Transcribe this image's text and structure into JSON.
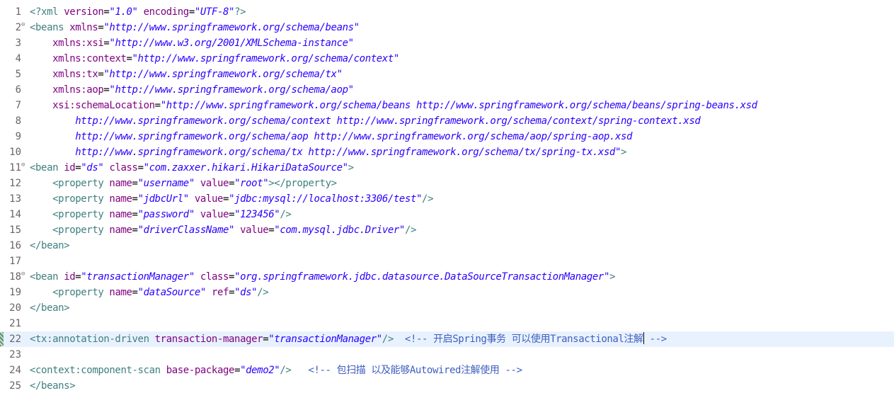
{
  "editor": {
    "current_line": 22,
    "lines": [
      {
        "n": "1",
        "fold": "",
        "tokens": [
          {
            "t": "tag",
            "s": "<?xml "
          },
          {
            "t": "attr",
            "s": "version"
          },
          {
            "t": "text",
            "s": "="
          },
          {
            "t": "val",
            "s": "\"1.0\""
          },
          {
            "t": "text",
            "s": " "
          },
          {
            "t": "attr",
            "s": "encoding"
          },
          {
            "t": "text",
            "s": "="
          },
          {
            "t": "val",
            "s": "\"UTF-8\""
          },
          {
            "t": "tag",
            "s": "?>"
          }
        ]
      },
      {
        "n": "2",
        "fold": "⊖",
        "tokens": [
          {
            "t": "tag",
            "s": "<beans "
          },
          {
            "t": "attr",
            "s": "xmlns"
          },
          {
            "t": "text",
            "s": "="
          },
          {
            "t": "val",
            "s": "\"http://www.springframework.org/schema/beans\""
          }
        ]
      },
      {
        "n": "3",
        "fold": "",
        "tokens": [
          {
            "t": "text",
            "s": "    "
          },
          {
            "t": "attr",
            "s": "xmlns:xsi"
          },
          {
            "t": "text",
            "s": "="
          },
          {
            "t": "val",
            "s": "\"http://www.w3.org/2001/XMLSchema-instance\""
          }
        ]
      },
      {
        "n": "4",
        "fold": "",
        "tokens": [
          {
            "t": "text",
            "s": "    "
          },
          {
            "t": "attr",
            "s": "xmlns:context"
          },
          {
            "t": "text",
            "s": "="
          },
          {
            "t": "val",
            "s": "\"http://www.springframework.org/schema/context\""
          }
        ]
      },
      {
        "n": "5",
        "fold": "",
        "tokens": [
          {
            "t": "text",
            "s": "    "
          },
          {
            "t": "attr",
            "s": "xmlns:tx"
          },
          {
            "t": "text",
            "s": "="
          },
          {
            "t": "val",
            "s": "\"http://www.springframework.org/schema/tx\""
          }
        ]
      },
      {
        "n": "6",
        "fold": "",
        "tokens": [
          {
            "t": "text",
            "s": "    "
          },
          {
            "t": "attr",
            "s": "xmlns:aop"
          },
          {
            "t": "text",
            "s": "="
          },
          {
            "t": "val",
            "s": "\"http://www.springframework.org/schema/aop\""
          }
        ]
      },
      {
        "n": "7",
        "fold": "",
        "tokens": [
          {
            "t": "text",
            "s": "    "
          },
          {
            "t": "attr",
            "s": "xsi:schemaLocation"
          },
          {
            "t": "text",
            "s": "="
          },
          {
            "t": "val",
            "s": "\"http://www.springframework.org/schema/beans http://www.springframework.org/schema/beans/spring-beans.xsd"
          }
        ]
      },
      {
        "n": "8",
        "fold": "",
        "tokens": [
          {
            "t": "text",
            "s": "        "
          },
          {
            "t": "val",
            "s": "http://www.springframework.org/schema/context http://www.springframework.org/schema/context/spring-context.xsd"
          }
        ]
      },
      {
        "n": "9",
        "fold": "",
        "tokens": [
          {
            "t": "text",
            "s": "        "
          },
          {
            "t": "val",
            "s": "http://www.springframework.org/schema/aop http://www.springframework.org/schema/aop/spring-aop.xsd"
          }
        ]
      },
      {
        "n": "10",
        "fold": "",
        "tokens": [
          {
            "t": "text",
            "s": "        "
          },
          {
            "t": "val",
            "s": "http://www.springframework.org/schema/tx http://www.springframework.org/schema/tx/spring-tx.xsd\""
          },
          {
            "t": "tag",
            "s": ">"
          }
        ]
      },
      {
        "n": "11",
        "fold": "⊖",
        "tokens": [
          {
            "t": "tag",
            "s": "<bean "
          },
          {
            "t": "attr",
            "s": "id"
          },
          {
            "t": "text",
            "s": "="
          },
          {
            "t": "val",
            "s": "\"ds\""
          },
          {
            "t": "text",
            "s": " "
          },
          {
            "t": "attr",
            "s": "class"
          },
          {
            "t": "text",
            "s": "="
          },
          {
            "t": "val",
            "s": "\"com.zaxxer.hikari.HikariDataSource\""
          },
          {
            "t": "tag",
            "s": ">"
          }
        ]
      },
      {
        "n": "12",
        "fold": "",
        "tokens": [
          {
            "t": "text",
            "s": "    "
          },
          {
            "t": "tag",
            "s": "<property "
          },
          {
            "t": "attr",
            "s": "name"
          },
          {
            "t": "text",
            "s": "="
          },
          {
            "t": "val",
            "s": "\"username\""
          },
          {
            "t": "text",
            "s": " "
          },
          {
            "t": "attr",
            "s": "value"
          },
          {
            "t": "text",
            "s": "="
          },
          {
            "t": "val",
            "s": "\"root\""
          },
          {
            "t": "tag",
            "s": "></property>"
          }
        ]
      },
      {
        "n": "13",
        "fold": "",
        "tokens": [
          {
            "t": "text",
            "s": "    "
          },
          {
            "t": "tag",
            "s": "<property "
          },
          {
            "t": "attr",
            "s": "name"
          },
          {
            "t": "text",
            "s": "="
          },
          {
            "t": "val",
            "s": "\"jdbcUrl\""
          },
          {
            "t": "text",
            "s": " "
          },
          {
            "t": "attr",
            "s": "value"
          },
          {
            "t": "text",
            "s": "="
          },
          {
            "t": "val",
            "s": "\"jdbc:mysql://localhost:3306/test\""
          },
          {
            "t": "tag",
            "s": "/>"
          }
        ]
      },
      {
        "n": "14",
        "fold": "",
        "tokens": [
          {
            "t": "text",
            "s": "    "
          },
          {
            "t": "tag",
            "s": "<property "
          },
          {
            "t": "attr",
            "s": "name"
          },
          {
            "t": "text",
            "s": "="
          },
          {
            "t": "val",
            "s": "\"password\""
          },
          {
            "t": "text",
            "s": " "
          },
          {
            "t": "attr",
            "s": "value"
          },
          {
            "t": "text",
            "s": "="
          },
          {
            "t": "val",
            "s": "\"123456\""
          },
          {
            "t": "tag",
            "s": "/>"
          }
        ]
      },
      {
        "n": "15",
        "fold": "",
        "tokens": [
          {
            "t": "text",
            "s": "    "
          },
          {
            "t": "tag",
            "s": "<property "
          },
          {
            "t": "attr",
            "s": "name"
          },
          {
            "t": "text",
            "s": "="
          },
          {
            "t": "val",
            "s": "\"driverClassName\""
          },
          {
            "t": "text",
            "s": " "
          },
          {
            "t": "attr",
            "s": "value"
          },
          {
            "t": "text",
            "s": "="
          },
          {
            "t": "val",
            "s": "\"com.mysql.jdbc.Driver\""
          },
          {
            "t": "tag",
            "s": "/>"
          }
        ]
      },
      {
        "n": "16",
        "fold": "",
        "tokens": [
          {
            "t": "tag",
            "s": "</bean>"
          }
        ]
      },
      {
        "n": "17",
        "fold": "",
        "tokens": []
      },
      {
        "n": "18",
        "fold": "⊖",
        "tokens": [
          {
            "t": "tag",
            "s": "<bean "
          },
          {
            "t": "attr",
            "s": "id"
          },
          {
            "t": "text",
            "s": "="
          },
          {
            "t": "val",
            "s": "\"transactionManager\""
          },
          {
            "t": "text",
            "s": " "
          },
          {
            "t": "attr",
            "s": "class"
          },
          {
            "t": "text",
            "s": "="
          },
          {
            "t": "val",
            "s": "\"org.springframework.jdbc.datasource.DataSourceTransactionManager\""
          },
          {
            "t": "tag",
            "s": ">"
          }
        ]
      },
      {
        "n": "19",
        "fold": "",
        "tokens": [
          {
            "t": "text",
            "s": "    "
          },
          {
            "t": "tag",
            "s": "<property "
          },
          {
            "t": "attr",
            "s": "name"
          },
          {
            "t": "text",
            "s": "="
          },
          {
            "t": "val",
            "s": "\"dataSource\""
          },
          {
            "t": "text",
            "s": " "
          },
          {
            "t": "attr",
            "s": "ref"
          },
          {
            "t": "text",
            "s": "="
          },
          {
            "t": "val",
            "s": "\"ds\""
          },
          {
            "t": "tag",
            "s": "/>"
          }
        ]
      },
      {
        "n": "20",
        "fold": "",
        "tokens": [
          {
            "t": "tag",
            "s": "</bean>"
          }
        ]
      },
      {
        "n": "21",
        "fold": "",
        "tokens": []
      },
      {
        "n": "22",
        "fold": "",
        "tokens": [
          {
            "t": "tag",
            "s": "<tx:annotation-driven "
          },
          {
            "t": "attr",
            "s": "transaction-manager"
          },
          {
            "t": "text",
            "s": "="
          },
          {
            "t": "val",
            "s": "\"transactionManager\""
          },
          {
            "t": "tag",
            "s": "/>"
          },
          {
            "t": "text",
            "s": "  "
          },
          {
            "t": "cmt",
            "s": "<!-- 开启Spring事务 可以使用Transactional注解"
          },
          {
            "t": "caret",
            "s": ""
          },
          {
            "t": "cmt",
            "s": " -->"
          }
        ]
      },
      {
        "n": "23",
        "fold": "",
        "tokens": []
      },
      {
        "n": "24",
        "fold": "",
        "tokens": [
          {
            "t": "tag",
            "s": "<context:component-scan "
          },
          {
            "t": "attr",
            "s": "base-package"
          },
          {
            "t": "text",
            "s": "="
          },
          {
            "t": "val",
            "s": "\"demo2\""
          },
          {
            "t": "tag",
            "s": "/>"
          },
          {
            "t": "text",
            "s": "   "
          },
          {
            "t": "cmt",
            "s": "<!-- 包扫描 以及能够Autowired注解使用 -->"
          }
        ]
      },
      {
        "n": "25",
        "fold": "",
        "tokens": [
          {
            "t": "tag",
            "s": "</beans>"
          }
        ]
      }
    ]
  }
}
